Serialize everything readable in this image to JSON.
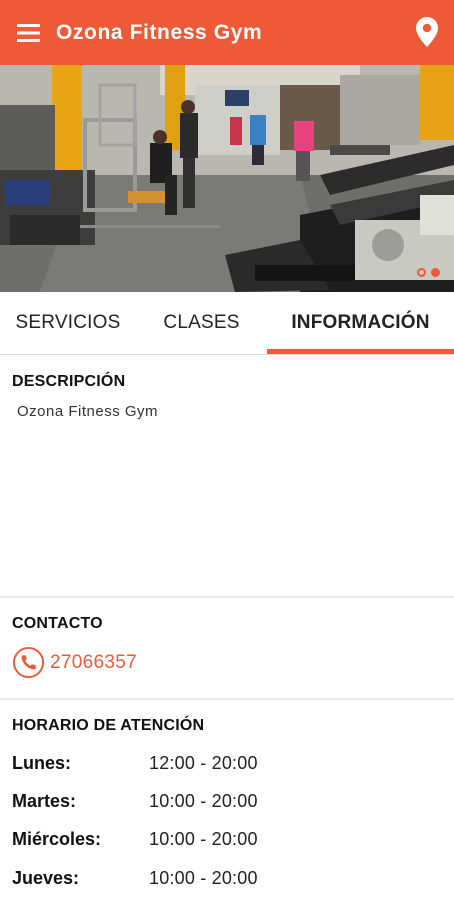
{
  "app": {
    "title": "Ozona Fitness Gym",
    "brand_color": "#ee5a37",
    "menu_icon": "hamburger-menu-icon",
    "location_icon": "map-pin-icon"
  },
  "hero": {
    "image_alt": "gym floor photo",
    "carousel": {
      "count": 2,
      "active_index": 1
    }
  },
  "tabs": [
    {
      "label": "SERVICIOS",
      "active": false
    },
    {
      "label": "CLASES",
      "active": false
    },
    {
      "label": "INFORMACIÓN",
      "active": true
    }
  ],
  "description": {
    "heading": "DESCRIPCIÓN",
    "text": "Ozona Fitness Gym"
  },
  "contact": {
    "heading": "CONTACTO",
    "phone_icon": "phone-icon",
    "phone": "27066357"
  },
  "schedule": {
    "heading": "HORARIO DE ATENCIÓN",
    "days": [
      {
        "day": "Lunes:",
        "hours": "12:00 - 20:00"
      },
      {
        "day": "Martes:",
        "hours": "10:00 - 20:00"
      },
      {
        "day": "Miércoles:",
        "hours": "10:00 - 20:00"
      },
      {
        "day": "Jueves:",
        "hours": "10:00 - 20:00"
      }
    ]
  }
}
